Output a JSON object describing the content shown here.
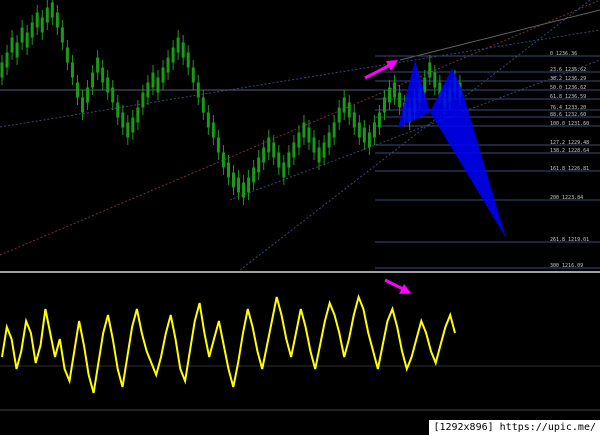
{
  "watermark": "[1292x896] https://upic.me/",
  "colors": {
    "background": "#000000",
    "candle": "#1a9a1a",
    "oscillator": "#ffff00",
    "pattern": "#0000ff",
    "arrow": "#ff00ff",
    "fib_line": "#3a4a7a",
    "channel_red": "#7a3030",
    "channel_blue": "#304a7a",
    "separator": "#a0a0a0"
  },
  "fib_levels": [
    "0 1236.36",
    "23.6 1235.62",
    "38.2 1236.29",
    "50.0 1236.62",
    "61.8 1236.59",
    "76.4 1233.20",
    "88.6 1232.60",
    "100.0 1231.60",
    "127.2 1229.48",
    "138.2 1228.64",
    "161.8 1226.81",
    "200 1223.84",
    "261.8 1219.01",
    "300 1216.09"
  ],
  "price_series": [
    1240,
    1242,
    1245,
    1244,
    1247,
    1246,
    1248,
    1250,
    1249,
    1251,
    1252,
    1250,
    1247,
    1243,
    1240,
    1236,
    1233,
    1235,
    1238,
    1241,
    1239,
    1237,
    1235,
    1232,
    1230,
    1228,
    1229,
    1231,
    1234,
    1236,
    1238,
    1237,
    1239,
    1241,
    1243,
    1245,
    1244,
    1242,
    1239,
    1236,
    1233,
    1230,
    1228,
    1225,
    1222,
    1220,
    1218,
    1217,
    1216,
    1217,
    1219,
    1221,
    1223,
    1225,
    1224,
    1222,
    1220,
    1222,
    1224,
    1226,
    1228,
    1227,
    1225,
    1223,
    1224,
    1226,
    1228,
    1231,
    1233,
    1232,
    1230,
    1228,
    1227,
    1226,
    1228,
    1230,
    1233,
    1235,
    1236,
    1234,
    1232,
    1231,
    1233,
    1235,
    1237,
    1240,
    1238,
    1236,
    1234,
    1235,
    1237,
    1236
  ],
  "oscillator_series": [
    40,
    65,
    55,
    30,
    45,
    70,
    60,
    35,
    50,
    80,
    60,
    40,
    55,
    30,
    20,
    45,
    70,
    50,
    25,
    10,
    35,
    60,
    75,
    55,
    30,
    15,
    40,
    65,
    80,
    60,
    45,
    35,
    25,
    40,
    60,
    75,
    55,
    30,
    20,
    45,
    70,
    85,
    60,
    40,
    55,
    70,
    50,
    30,
    15,
    35,
    60,
    80,
    65,
    45,
    30,
    50,
    70,
    90,
    75,
    55,
    40,
    60,
    80,
    65,
    45,
    30,
    50,
    70,
    85,
    75,
    60,
    40,
    55,
    75,
    90,
    80,
    60,
    45,
    30,
    50,
    70,
    80,
    65,
    45,
    30,
    40,
    55,
    70,
    60,
    45,
    35,
    50,
    65,
    75,
    60
  ]
}
